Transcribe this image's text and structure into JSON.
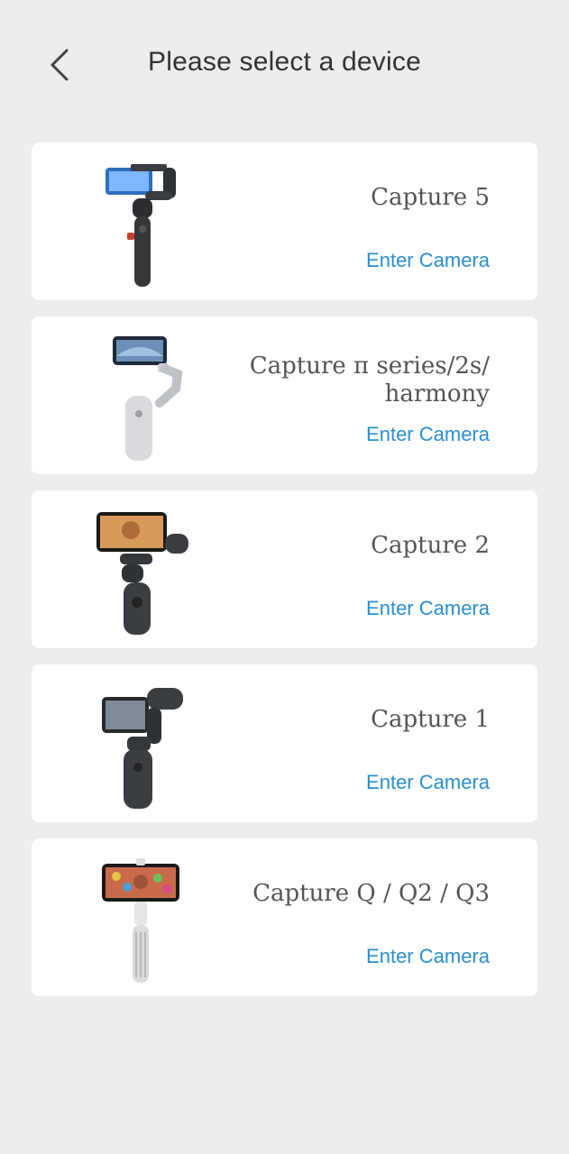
{
  "header": {
    "title": "Please select a device",
    "back_icon": "chevron-left-icon"
  },
  "devices": [
    {
      "name": "Capture 5",
      "action": "Enter Camera"
    },
    {
      "name": "Capture π series/2s/ harmony",
      "action": "Enter Camera"
    },
    {
      "name": "Capture 2",
      "action": "Enter Camera"
    },
    {
      "name": "Capture 1",
      "action": "Enter Camera"
    },
    {
      "name": "Capture Q / Q2 / Q3",
      "action": "Enter Camera"
    }
  ],
  "colors": {
    "background": "#ededed",
    "card": "#ffffff",
    "accent": "#2a8fd0",
    "title": "#333333"
  }
}
